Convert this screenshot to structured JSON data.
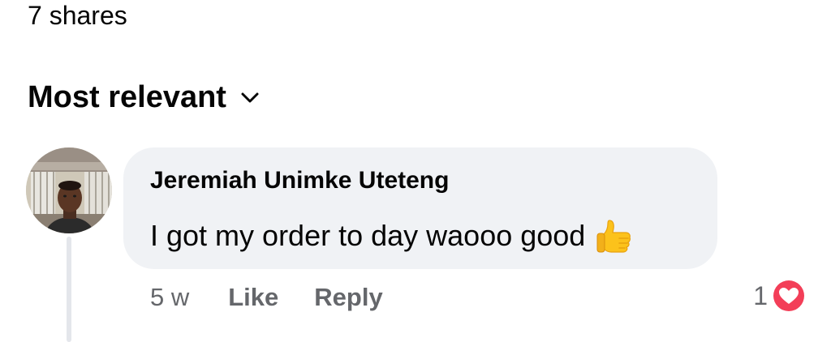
{
  "shares_text": "7 shares",
  "sort": {
    "label": "Most relevant",
    "icon": "chevron-down-icon"
  },
  "comment": {
    "author": "Jeremiah Unimke Uteteng",
    "text": "I got my order to day waooo good",
    "emoji": "thumbs-up-icon",
    "timestamp": "5 w",
    "like_label": "Like",
    "reply_label": "Reply",
    "reaction_count": "1",
    "reaction_icon": "heart-reaction-icon"
  },
  "colors": {
    "bubble": "#f0f2f5",
    "secondary_text": "#65676b",
    "heart": "#f33e58"
  }
}
